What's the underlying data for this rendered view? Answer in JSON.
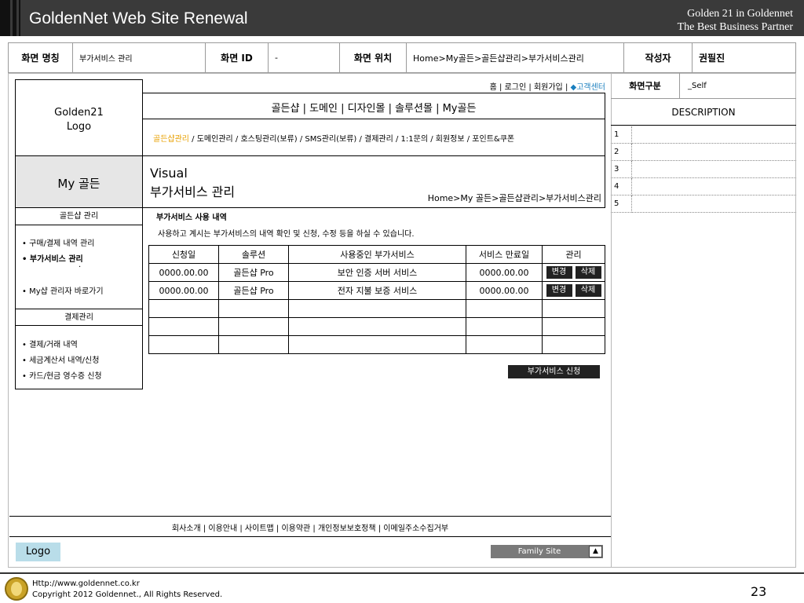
{
  "header": {
    "title": "GoldenNet Web Site Renewal",
    "tagline1": "Golden 21 in Goldennet",
    "tagline2": "The Best Business Partner"
  },
  "meta": {
    "name_label": "화면 명칭",
    "name_value": "부가서비스 관리",
    "id_label": "화면 ID",
    "id_value": "-",
    "location_label": "화면 위치",
    "location_value": "Home>My골든>골든샵관리>부가서비스관리",
    "author_label": "작성자",
    "author_value": "권필진"
  },
  "site": {
    "logo_text1": "Golden21",
    "logo_text2": "Logo",
    "util_links": [
      "홈",
      "로그인",
      "회원가입"
    ],
    "util_sep": "|",
    "customer_center": "◆고객센터",
    "gnb": "골든샵 | 도메인 | 디자인몰 | 솔루션몰 | My골든",
    "sub_active": "골든샵관리",
    "sub_rest": " / 도메인관리 / 호스팅관리(보류) / SMS관리(보류) / 결제관리 / 1:1문의 / 회원정보 / 포인트&쿠폰"
  },
  "left_nav": {
    "title": "My 골든",
    "section1": "골든샵 관리",
    "items1": [
      "• 구매/결제 내역 관리",
      "• 부가서비스 관리",
      "·",
      "• My샵 관리자 바로가기"
    ],
    "section2": "결제관리",
    "items2": [
      "• 결제/거래 내역",
      "• 세금계산서 내역/신청",
      "• 카드/현금 영수증 신청"
    ]
  },
  "visual": {
    "line1": "Visual",
    "line2": "부가서비스 관리",
    "breadcrumb": "Home>My 골든>골든샵관리>부가서비스관리"
  },
  "content": {
    "section_title": "부가서비스 사용 내역",
    "description": "사용하고 계시는 부가서비스의 내역 확인 및 신청, 수정 등을 하실 수 있습니다.",
    "columns": [
      "신청일",
      "솔루션",
      "사용중인 부가서비스",
      "서비스 만료일",
      "관리"
    ],
    "rows": [
      {
        "date": "0000.00.00",
        "solution": "골든샵 Pro",
        "service": "보안 인증 서버 서비스",
        "expire": "0000.00.00"
      },
      {
        "date": "0000.00.00",
        "solution": "골든샵 Pro",
        "service": "전자 지불 보증 서비스",
        "expire": "0000.00.00"
      }
    ],
    "edit_label": "변경",
    "delete_label": "삭제",
    "apply_label": "부가서비스 신청"
  },
  "footer": {
    "links": "회사소개 | 이용안내 | 사이트맵 | 이용약관 | 개인정보보호정책 | 이메일주소수집거부",
    "logo": "Logo",
    "family_site": "Family Site",
    "family_arrow": "▲"
  },
  "right_panel": {
    "screen_type_label": "화면구분",
    "screen_type_value": "_Self",
    "description_title": "DESCRIPTION",
    "numbers": [
      "1",
      "2",
      "3",
      "4",
      "5"
    ]
  },
  "page_footer": {
    "url": "Http://www.goldennet.co.kr",
    "copyright": "Copyright 2012 Goldennet., All Rights Reserved.",
    "page_number": "23"
  },
  "colors": {
    "header_bg": "#3a3a3a",
    "accent_orange": "#e8a000",
    "customer_center_blue": "#1a7fbf",
    "nav_title_bg": "#e6e6e6",
    "logo_bg": "#b9dde9",
    "family_bg": "#7a7a7a"
  }
}
